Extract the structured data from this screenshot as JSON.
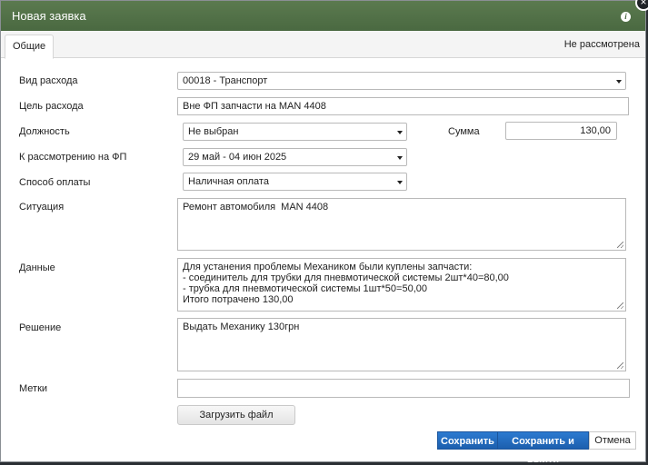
{
  "window": {
    "title": "Новая заявка",
    "close_glyph": "×",
    "info_glyph": "i"
  },
  "tabs": [
    {
      "label": "Общие"
    }
  ],
  "status": "Не рассмотрена",
  "form": {
    "expense_type": {
      "label": "Вид расхода",
      "value": "00018 - Транспорт"
    },
    "purpose": {
      "label": "Цель расхода",
      "value": "Вне ФП запчасти на MAN 4408"
    },
    "position": {
      "label": "Должность",
      "value": "Не выбран"
    },
    "amount": {
      "label": "Сумма",
      "value": "130,00"
    },
    "review_period": {
      "label": "К рассмотрению на ФП",
      "value": "29 май - 04 июн 2025"
    },
    "payment_method": {
      "label": "Способ оплаты",
      "value": "Наличная оплата"
    },
    "situation": {
      "label": "Ситуация",
      "lines": [
        "Ремонт автомобиля  MAN 4408"
      ]
    },
    "data": {
      "label": "Данные",
      "lines": [
        "Для устанения проблемы Механиком были куплены запчасти:",
        "- соединитель для трубки для пневмотической системы 2шт*40=80,00",
        "- трубка для пневмотической системы 1шт*50=50,00",
        "Итого потрачено 130,00"
      ]
    },
    "decision": {
      "label": "Решение",
      "lines": [
        "Выдать Механику 130грн"
      ]
    },
    "tags": {
      "label": "Метки",
      "value": ""
    }
  },
  "buttons": {
    "upload": "Загрузить файл",
    "save": "Сохранить",
    "save_exit": "Сохранить и выйти",
    "cancel": "Отмена"
  },
  "colors": {
    "titlebar": "#4a6941",
    "primary": "#1c5fae"
  }
}
